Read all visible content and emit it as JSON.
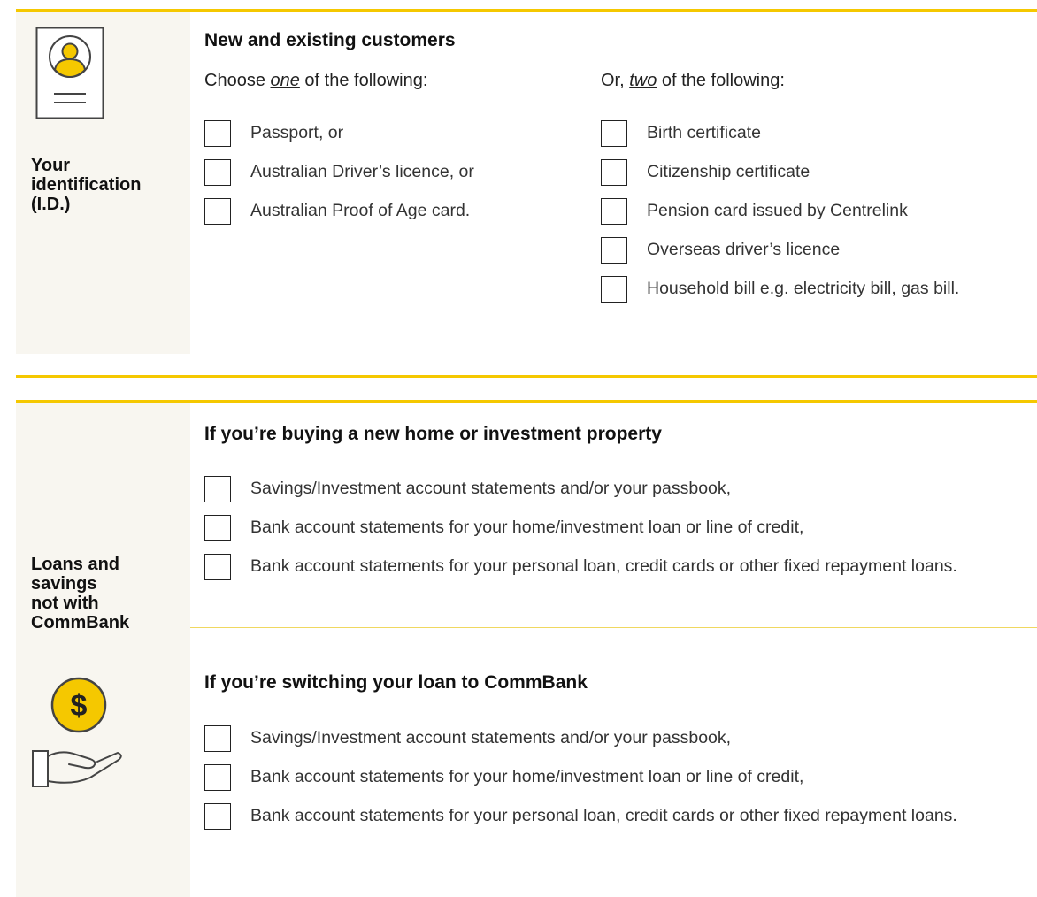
{
  "colors": {
    "accent": "#f5c800",
    "sidebar_bg": "#f8f6f0",
    "icon_stroke": "#444444"
  },
  "identification": {
    "label": "Your\nidentification\n(I.D.)",
    "icon": "id-card-icon",
    "heading": "New and existing customers",
    "choose_prefix": "Choose ",
    "choose_em": "one",
    "choose_suffix": " of the following:",
    "or_prefix": "Or, ",
    "or_em": "two",
    "or_suffix": " of the following:",
    "left_items": [
      "Passport, or",
      "Australian Driver’s licence, or",
      "Australian Proof of Age card."
    ],
    "right_items": [
      "Birth certificate",
      "Citizenship certificate",
      "Pension card issued by Centrelink",
      "Overseas driver’s licence",
      "Household bill e.g. electricity bill, gas bill."
    ]
  },
  "loans": {
    "label": "Loans and\nsavings\nnot with\nCommBank",
    "icon": "dollar-hand-icon",
    "dollar_symbol": "$",
    "buying_heading": "If you’re buying a new home or investment property",
    "buying_items": [
      "Savings/Investment account statements and/or your passbook,",
      "Bank account statements for your home/investment loan or line of credit,",
      "Bank account statements for your personal loan, credit cards or other fixed repayment loans."
    ],
    "switching_heading": "If you’re switching your loan to CommBank",
    "switching_items": [
      "Savings/Investment account statements and/or your passbook,",
      "Bank account statements for your home/investment loan or line of credit,",
      "Bank account statements for your personal loan, credit cards or other fixed repayment loans."
    ]
  }
}
